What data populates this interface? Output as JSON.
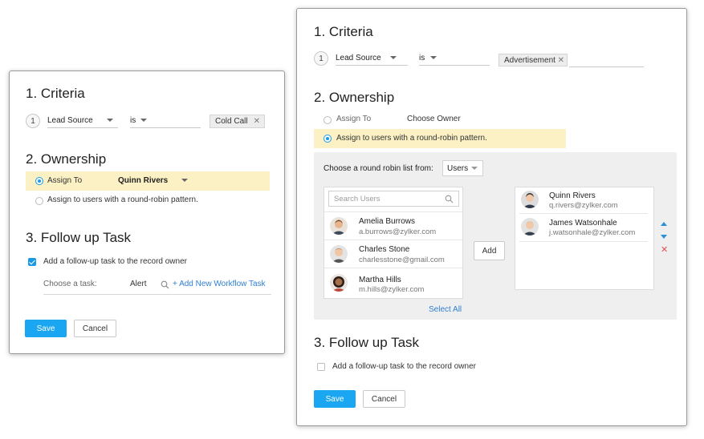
{
  "left_panel": {
    "criteria": {
      "heading": "1. Criteria",
      "step": "1",
      "field": "Lead Source",
      "operator": "is",
      "value": "Cold Call"
    },
    "ownership": {
      "heading": "2. Ownership",
      "assign_to_label": "Assign To",
      "assign_to_value": "Quinn Rivers",
      "round_robin_label": "Assign to users with a round-robin pattern.",
      "selected": "assign_to"
    },
    "followup": {
      "heading": "3. Follow up Task",
      "checkbox_label": "Add a follow-up task to the record owner",
      "checked": true,
      "choose_label": "Choose a task:",
      "task_value": "Alert",
      "add_link": "+ Add New Workflow Task"
    },
    "save_label": "Save",
    "cancel_label": "Cancel"
  },
  "right_panel": {
    "criteria": {
      "heading": "1. Criteria",
      "step": "1",
      "field": "Lead Source",
      "operator": "is",
      "value": "Advertisement"
    },
    "ownership": {
      "heading": "2. Ownership",
      "assign_to_label": "Assign To",
      "assign_to_value": "Choose Owner",
      "round_robin_label": "Assign to users with a round-robin pattern.",
      "selected": "round_robin",
      "rr_list_label": "Choose a round robin list from:",
      "rr_list_value": "Users",
      "search_placeholder": "Search Users",
      "available_users": [
        {
          "name": "Amelia Burrows",
          "email": "a.burrows@zylker.com"
        },
        {
          "name": "Charles Stone",
          "email": "charlesstone@gmail.com"
        },
        {
          "name": "Martha Hills",
          "email": "m.hills@zylker.com"
        }
      ],
      "add_label": "Add",
      "select_all_label": "Select All",
      "selected_users": [
        {
          "name": "Quinn Rivers",
          "email": "q.rivers@zylker.com"
        },
        {
          "name": "James Watsonhale",
          "email": "j.watsonhale@zylker.com"
        }
      ]
    },
    "followup": {
      "heading": "3. Follow up Task",
      "checkbox_label": "Add a follow-up task to the record owner",
      "checked": false
    },
    "save_label": "Save",
    "cancel_label": "Cancel"
  },
  "colors": {
    "accent": "#1aa6f0",
    "highlight": "#fbf1c4",
    "link": "#2f7fd3",
    "remove": "#e05050"
  },
  "icons": [
    "search-icon",
    "chevron-down-icon",
    "close-icon",
    "move-up-icon",
    "move-down-icon",
    "remove-icon"
  ]
}
